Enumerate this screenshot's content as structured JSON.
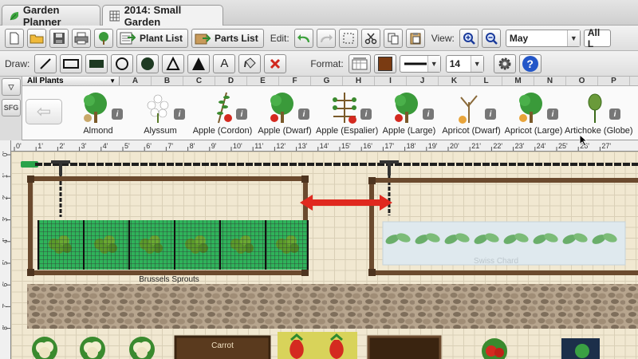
{
  "tabs": [
    {
      "label": "Garden Planner",
      "icon": "leaf-icon"
    },
    {
      "label": "2014: Small Garden",
      "icon": "grid-icon"
    }
  ],
  "toolbar": {
    "plant_list_label": "Plant List",
    "parts_list_label": "Parts List",
    "edit_label": "Edit:",
    "view_label": "View:",
    "month_value": "May",
    "filter_value": "All L",
    "draw_label": "Draw:",
    "format_label": "Format:",
    "text_tool_glyph": "A",
    "font_size_value": "14",
    "help_glyph": "?"
  },
  "library": {
    "dropdown_value": "All Plants",
    "columns": [
      "A",
      "B",
      "C",
      "D",
      "E",
      "F",
      "G",
      "H",
      "I",
      "J",
      "K",
      "L",
      "M",
      "N",
      "O",
      "P"
    ],
    "side_filter_glyph": "▽",
    "side_sfg_label": "SFG",
    "info_glyph": "i",
    "plants": [
      {
        "name": "Almond",
        "icon": "almond-tree-icon"
      },
      {
        "name": "Alyssum",
        "icon": "alyssum-flower-icon"
      },
      {
        "name": "Apple (Cordon)",
        "icon": "apple-cordon-icon"
      },
      {
        "name": "Apple (Dwarf)",
        "icon": "apple-dwarf-icon"
      },
      {
        "name": "Apple (Espalier)",
        "icon": "apple-espalier-icon"
      },
      {
        "name": "Apple (Large)",
        "icon": "apple-large-icon"
      },
      {
        "name": "Apricot (Dwarf)",
        "icon": "apricot-dwarf-icon"
      },
      {
        "name": "Apricot (Large)",
        "icon": "apricot-large-icon"
      },
      {
        "name": "Artichoke (Globe)",
        "icon": "artichoke-icon"
      },
      {
        "name": "Ar",
        "icon": "artichoke-jerusalem-icon"
      }
    ]
  },
  "ruler": {
    "top": [
      "0'",
      "1'",
      "2'",
      "3'",
      "4'",
      "5'",
      "6'",
      "7'",
      "8'",
      "9'",
      "10'",
      "11'",
      "12'",
      "13'",
      "14'",
      "15'",
      "16'",
      "17'",
      "18'",
      "19'",
      "20'",
      "21'",
      "22'",
      "23'",
      "24'",
      "25'",
      "26'",
      "27'"
    ],
    "left": [
      "0'",
      "1'",
      "2'",
      "3'",
      "4'",
      "5'",
      "6'",
      "7'",
      "8'"
    ]
  },
  "garden": {
    "bed1_label": "Brussels Sprouts",
    "bed2_label": "Swiss Chard",
    "carrot_label": "Carrot"
  },
  "colors": {
    "bed_border": "#6b4a2e",
    "hose": "#1e1e1e",
    "arrow": "#e0291f",
    "net_green": "#2fb35a",
    "path_stone": "#9c8c78",
    "color_swatch": "#7a3b12"
  }
}
